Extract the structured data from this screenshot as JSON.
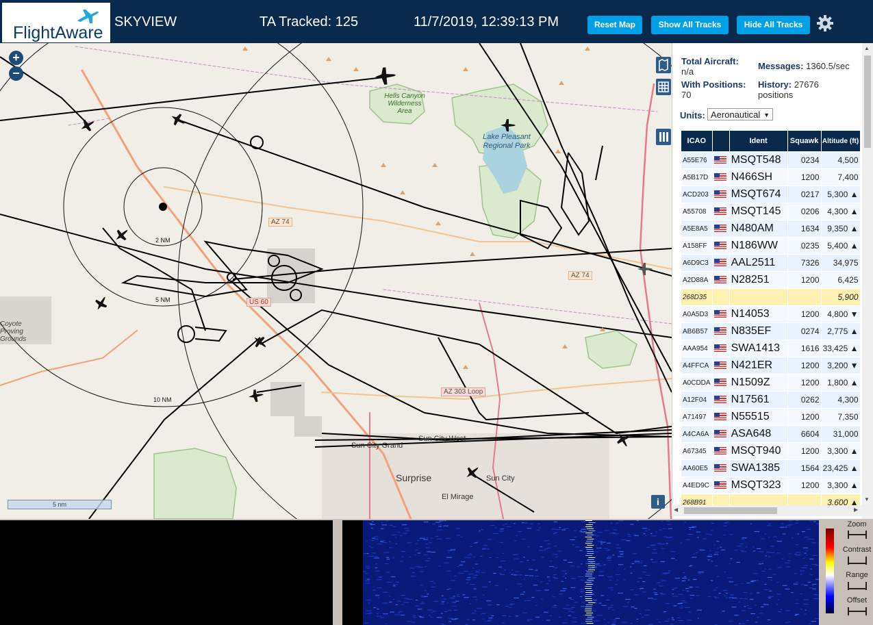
{
  "header": {
    "logo": "FlightAware",
    "app_title": "SKYVIEW",
    "tracked": "TA Tracked: 125",
    "datetime": "11/7/2019, 12:39:13 PM",
    "buttons": [
      "Reset Map",
      "Show All Tracks",
      "Hide All Tracks"
    ]
  },
  "map": {
    "zoom_in": "+",
    "zoom_out": "−",
    "scale": "5 nm",
    "range_rings": [
      "2 NM",
      "5 NM",
      "10 NM"
    ],
    "labels": {
      "wilderness": "Hells Canyon Wilderness Area",
      "lake": "Lake Pleasant Regional Park",
      "az74a": "AZ 74",
      "az74b": "AZ 74",
      "us60": "US 60",
      "az303": "AZ 303 Loop",
      "suncitygrand": "Sun City Grand",
      "suncitywest": "Sun City West",
      "surprise": "Surprise",
      "suncity": "Sun City",
      "elmirage": "El Mirage",
      "coyote": "Coyote Proving Grounds"
    },
    "info": "i"
  },
  "panel": {
    "total_aircraft_label": "Total Aircraft:",
    "total_aircraft_value": "n/a",
    "messages_label": "Messages:",
    "messages_value": "1360.5/sec",
    "with_positions_label": "With Positions:",
    "with_positions_value": "70",
    "history_label": "History:",
    "history_value": "27676 positions",
    "units_label": "Units:",
    "units_value": "Aeronautical",
    "columns": [
      "ICAO",
      "",
      "Ident",
      "Squawk",
      "Altitude (ft)"
    ],
    "rows": [
      {
        "icao": "A55E76",
        "ident": "MSQT548",
        "squawk": "0234",
        "alt": "4,500"
      },
      {
        "icao": "A5B17D",
        "ident": "N466SH",
        "squawk": "1200",
        "alt": "7,400"
      },
      {
        "icao": "ACD203",
        "ident": "MSQT674",
        "squawk": "0217",
        "alt": "5,300 ▲"
      },
      {
        "icao": "A55708",
        "ident": "MSQT145",
        "squawk": "0206",
        "alt": "4,300 ▲"
      },
      {
        "icao": "A5E8A5",
        "ident": "N480AM",
        "squawk": "1634",
        "alt": "9,350 ▲"
      },
      {
        "icao": "A158FF",
        "ident": "N186WW",
        "squawk": "0235",
        "alt": "5,400 ▲"
      },
      {
        "icao": "A6D9C3",
        "ident": "AAL2511",
        "squawk": "7326",
        "alt": "34,975"
      },
      {
        "icao": "A2D88A",
        "ident": "N28251",
        "squawk": "1200",
        "alt": "6,425"
      },
      {
        "icao": "268D35",
        "ident": "",
        "squawk": "",
        "alt": "5,900",
        "nopos": true
      },
      {
        "icao": "A0A5D3",
        "ident": "N14053",
        "squawk": "1200",
        "alt": "4,800 ▼"
      },
      {
        "icao": "AB6B57",
        "ident": "N835EF",
        "squawk": "0274",
        "alt": "2,775 ▲"
      },
      {
        "icao": "AAA954",
        "ident": "SWA1413",
        "squawk": "1616",
        "alt": "33,425 ▲"
      },
      {
        "icao": "A4FFCA",
        "ident": "N421ER",
        "squawk": "1200",
        "alt": "3,200 ▼"
      },
      {
        "icao": "A0CDDA",
        "ident": "N1509Z",
        "squawk": "1200",
        "alt": "1,800 ▲"
      },
      {
        "icao": "A12F04",
        "ident": "N17561",
        "squawk": "0262",
        "alt": "4,300"
      },
      {
        "icao": "A71497",
        "ident": "N55515",
        "squawk": "1200",
        "alt": "7,350"
      },
      {
        "icao": "A4CA6A",
        "ident": "ASA648",
        "squawk": "6604",
        "alt": "31,000"
      },
      {
        "icao": "A67345",
        "ident": "MSQT940",
        "squawk": "1200",
        "alt": "3,300 ▲"
      },
      {
        "icao": "AA60E5",
        "ident": "SWA1385",
        "squawk": "1564",
        "alt": "23,425 ▲"
      },
      {
        "icao": "A4ED9C",
        "ident": "MSQT323",
        "squawk": "1200",
        "alt": "3,300 ▲"
      },
      {
        "icao": "268B91",
        "ident": "",
        "squawk": "",
        "alt": "3,600 ▲",
        "nopos": true
      }
    ]
  },
  "spectrum": {
    "controls": [
      "Zoom",
      "Contrast",
      "Range",
      "Offset"
    ]
  },
  "colors": {
    "header_bg": "#0a2a4d",
    "button_bg": "#00a0e6",
    "map_bg": "#f1eee7",
    "row_bg": "#e8f3ff",
    "nopos_row_bg": "#fff0b3"
  }
}
